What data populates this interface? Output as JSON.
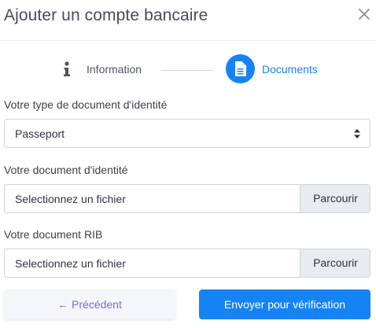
{
  "modal": {
    "title": "Ajouter un compte bancaire",
    "close_icon": "close-icon"
  },
  "steps": [
    {
      "label": "Information",
      "icon": "info-icon",
      "active": false
    },
    {
      "label": "Documents",
      "icon": "document-icon",
      "active": true
    }
  ],
  "form": {
    "id_type": {
      "label": "Votre type de document d'identité",
      "selected": "Passeport"
    },
    "id_document": {
      "label": "Votre document d'identité",
      "placeholder": "Selectionnez un fichier",
      "browse_label": "Parcourir"
    },
    "rib_document": {
      "label": "Votre document RIB",
      "placeholder": "Selectionnez un fichier",
      "browse_label": "Parcourir"
    }
  },
  "footer": {
    "previous_label": "← Précédent",
    "submit_label": "Envoyer pour vérification"
  },
  "colors": {
    "accent": "#1683f5",
    "previous_text": "#6f6fd6",
    "text": "#3d3f4c",
    "border": "#cfd4da",
    "addon_bg": "#e9ecef"
  }
}
